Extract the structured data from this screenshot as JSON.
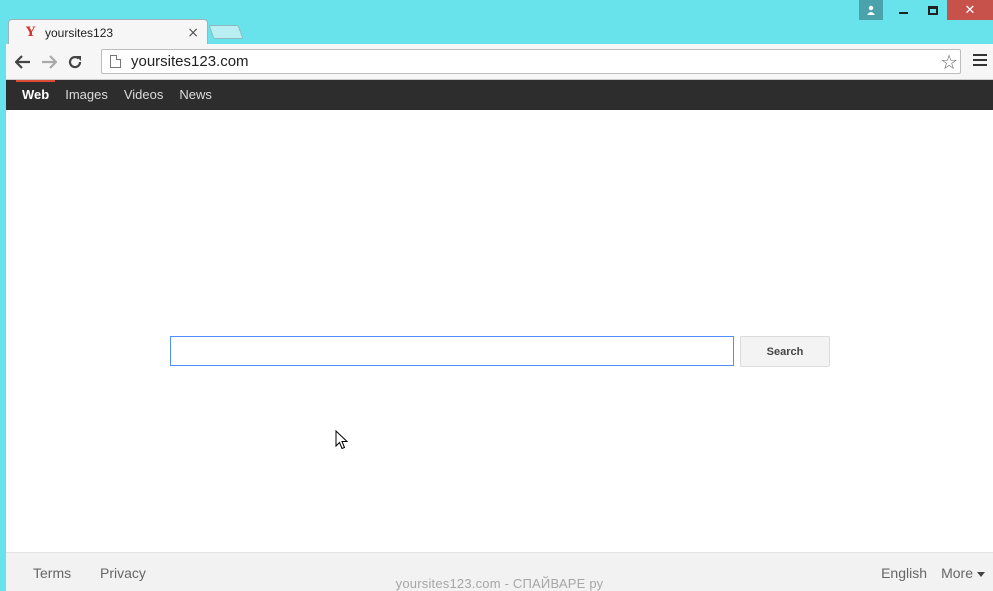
{
  "tab": {
    "title": "yoursites123",
    "favicon": "Y"
  },
  "omnibox": {
    "url": "yoursites123.com"
  },
  "topnav": {
    "items": [
      {
        "label": "Web",
        "active": true
      },
      {
        "label": "Images"
      },
      {
        "label": "Videos"
      },
      {
        "label": "News"
      }
    ]
  },
  "search": {
    "value": "",
    "button_label": "Search"
  },
  "footer": {
    "terms": "Terms",
    "privacy": "Privacy",
    "language": "English",
    "more": "More"
  },
  "watermark": "yoursites123.com - СПАЙВАРЕ ру",
  "colors": {
    "window_frame": "#68e3eb",
    "topnav_bg": "#2d2d2d",
    "active_indicator": "#dd4b39",
    "close_button": "#c7514b",
    "search_focus_border": "#4d90fe"
  }
}
